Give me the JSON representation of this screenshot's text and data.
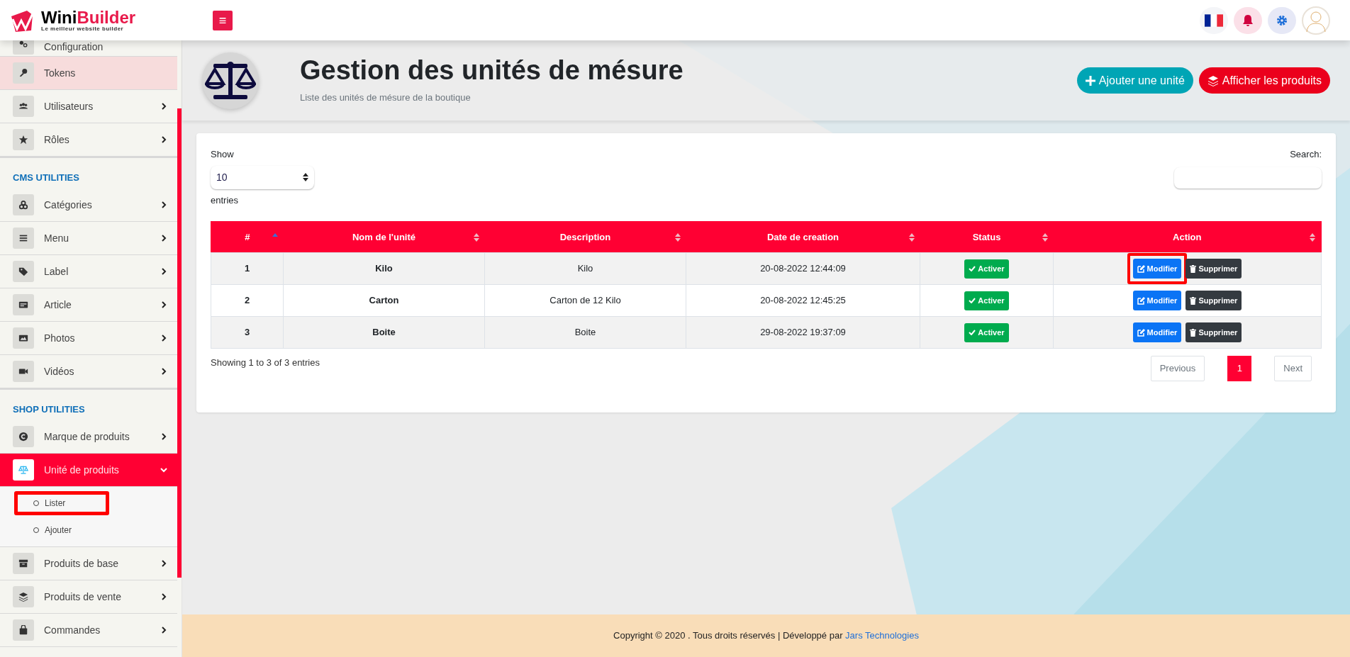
{
  "header": {
    "logo_word_1": "Wini",
    "logo_word_2": "Builder",
    "logo_tagline": "Le meilleur website builder",
    "menu_button": "≡"
  },
  "sidebar": {
    "items": [
      {
        "kind": "item",
        "label": "Configuration",
        "has_submenu": false,
        "highlighted": false,
        "selected": false
      },
      {
        "kind": "item",
        "label": "Tokens",
        "has_submenu": false,
        "highlighted": true,
        "selected": false
      },
      {
        "kind": "item",
        "label": "Utilisateurs",
        "has_submenu": true,
        "highlighted": false,
        "selected": false
      },
      {
        "kind": "item",
        "label": "Rôles",
        "has_submenu": true,
        "highlighted": false,
        "selected": false
      },
      {
        "kind": "section",
        "label": "CMS UTILITIES"
      },
      {
        "kind": "item",
        "label": "Catégories",
        "has_submenu": true,
        "highlighted": false,
        "selected": false
      },
      {
        "kind": "item",
        "label": "Menu",
        "has_submenu": true,
        "highlighted": false,
        "selected": false
      },
      {
        "kind": "item",
        "label": "Label",
        "has_submenu": true,
        "highlighted": false,
        "selected": false
      },
      {
        "kind": "item",
        "label": "Article",
        "has_submenu": true,
        "highlighted": false,
        "selected": false
      },
      {
        "kind": "item",
        "label": "Photos",
        "has_submenu": true,
        "highlighted": false,
        "selected": false
      },
      {
        "kind": "item",
        "label": "Vidéos",
        "has_submenu": true,
        "highlighted": false,
        "selected": false
      },
      {
        "kind": "section",
        "label": "SHOP UTILITIES"
      },
      {
        "kind": "item",
        "label": "Marque de produits",
        "has_submenu": true,
        "highlighted": false,
        "selected": false
      },
      {
        "kind": "item",
        "label": "Unité de produits",
        "has_submenu": true,
        "highlighted": false,
        "selected": true,
        "expanded": true,
        "children": [
          {
            "label": "Lister",
            "annotated": true
          },
          {
            "label": "Ajouter",
            "annotated": false
          }
        ]
      },
      {
        "kind": "item",
        "label": "Produits de base",
        "has_submenu": true,
        "highlighted": false,
        "selected": false
      },
      {
        "kind": "item",
        "label": "Produits de vente",
        "has_submenu": true,
        "highlighted": false,
        "selected": false
      },
      {
        "kind": "item",
        "label": "Commandes",
        "has_submenu": true,
        "highlighted": false,
        "selected": false
      }
    ]
  },
  "page_header": {
    "title": "Gestion des unités de mésure",
    "subtitle": "Liste des unités de mésure de la boutique",
    "buttons": [
      {
        "kind": "add",
        "label": "Ajouter une unité"
      },
      {
        "kind": "products",
        "label": "Afficher les produits"
      }
    ]
  },
  "table_controls": {
    "show_label": "Show",
    "page_size": "10",
    "entries_label": "entries",
    "search_label": "Search:"
  },
  "table": {
    "columns": [
      {
        "label": "#",
        "sorted_ascending": true
      },
      {
        "label": "Nom de l'unité",
        "sorted_ascending": false
      },
      {
        "label": "Description",
        "sorted_ascending": false
      },
      {
        "label": "Date de creation",
        "sorted_ascending": false
      },
      {
        "label": "Status",
        "sorted_ascending": false
      },
      {
        "label": "Action",
        "sorted_ascending": false
      }
    ],
    "rows": [
      {
        "number": "1",
        "name": "Kilo",
        "description": "Kilo",
        "created": "20-08-2022 12:44:09",
        "status": "Activer",
        "actions": [
          {
            "kind": "edit",
            "label": "Modifier",
            "annotated": true
          },
          {
            "kind": "delete",
            "label": "Supprimer",
            "annotated": false
          }
        ]
      },
      {
        "number": "2",
        "name": "Carton",
        "description": "Carton de 12 Kilo",
        "created": "20-08-2022 12:45:25",
        "status": "Activer",
        "actions": [
          {
            "kind": "edit",
            "label": "Modifier",
            "annotated": false
          },
          {
            "kind": "delete",
            "label": "Supprimer",
            "annotated": false
          }
        ]
      },
      {
        "number": "3",
        "name": "Boite",
        "description": "Boite",
        "created": "29-08-2022 19:37:09",
        "status": "Activer",
        "actions": [
          {
            "kind": "edit",
            "label": "Modifier",
            "annotated": false
          },
          {
            "kind": "delete",
            "label": "Supprimer",
            "annotated": false
          }
        ]
      }
    ]
  },
  "table_info": "Showing 1 to 3 of 3 entries",
  "pagination": {
    "previous": "Previous",
    "pages": [
      {
        "label": "1",
        "selected": true
      }
    ],
    "next": "Next"
  },
  "footer": {
    "text": "Copyright © 2020 . Tous droits réservés | Développé par",
    "link": "Jars Technologies"
  }
}
